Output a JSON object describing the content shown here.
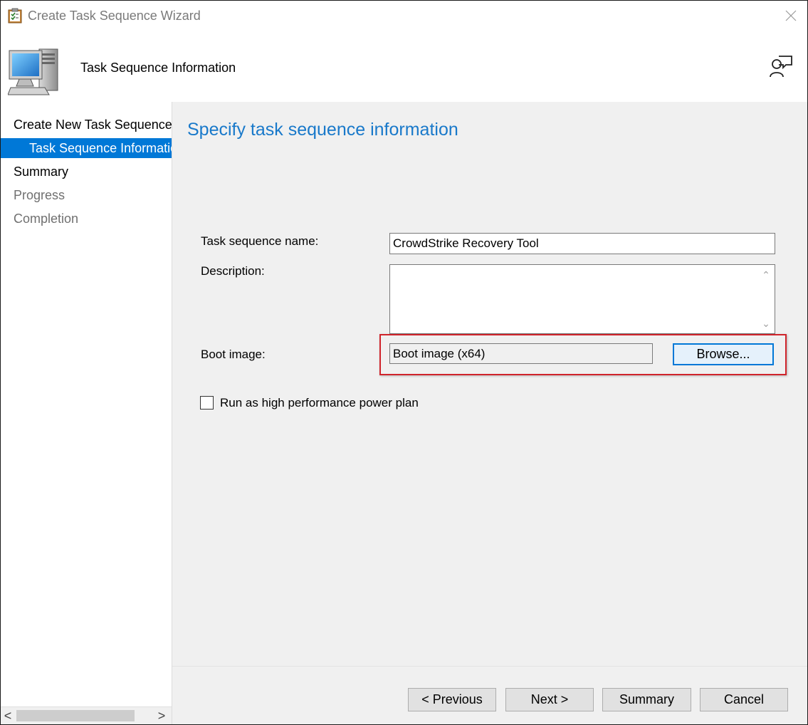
{
  "window": {
    "title": "Create Task Sequence Wizard"
  },
  "header": {
    "title": "Task Sequence Information"
  },
  "sidebar": {
    "items": [
      {
        "label": "Create New Task Sequence",
        "state": "enabled"
      },
      {
        "label": "Task Sequence Information",
        "state": "selected"
      },
      {
        "label": "Summary",
        "state": "enabled"
      },
      {
        "label": "Progress",
        "state": "disabled"
      },
      {
        "label": "Completion",
        "state": "disabled"
      }
    ],
    "scroll_left": "<",
    "scroll_right": ">"
  },
  "main": {
    "heading": "Specify task sequence information",
    "task_sequence_name_label": "Task sequence name:",
    "task_sequence_name_value": "CrowdStrike Recovery Tool",
    "description_label": "Description:",
    "description_value": "",
    "boot_image_label": "Boot image:",
    "boot_image_value": "Boot image (x64)",
    "browse_label": "Browse...",
    "high_perf_label": "Run as high performance power plan",
    "high_perf_checked": false
  },
  "footer": {
    "previous_label": "< Previous",
    "next_label": "Next >",
    "summary_label": "Summary",
    "cancel_label": "Cancel"
  },
  "colors": {
    "accent": "#0078d7",
    "heading": "#1979ca",
    "highlight": "#d0242b"
  }
}
